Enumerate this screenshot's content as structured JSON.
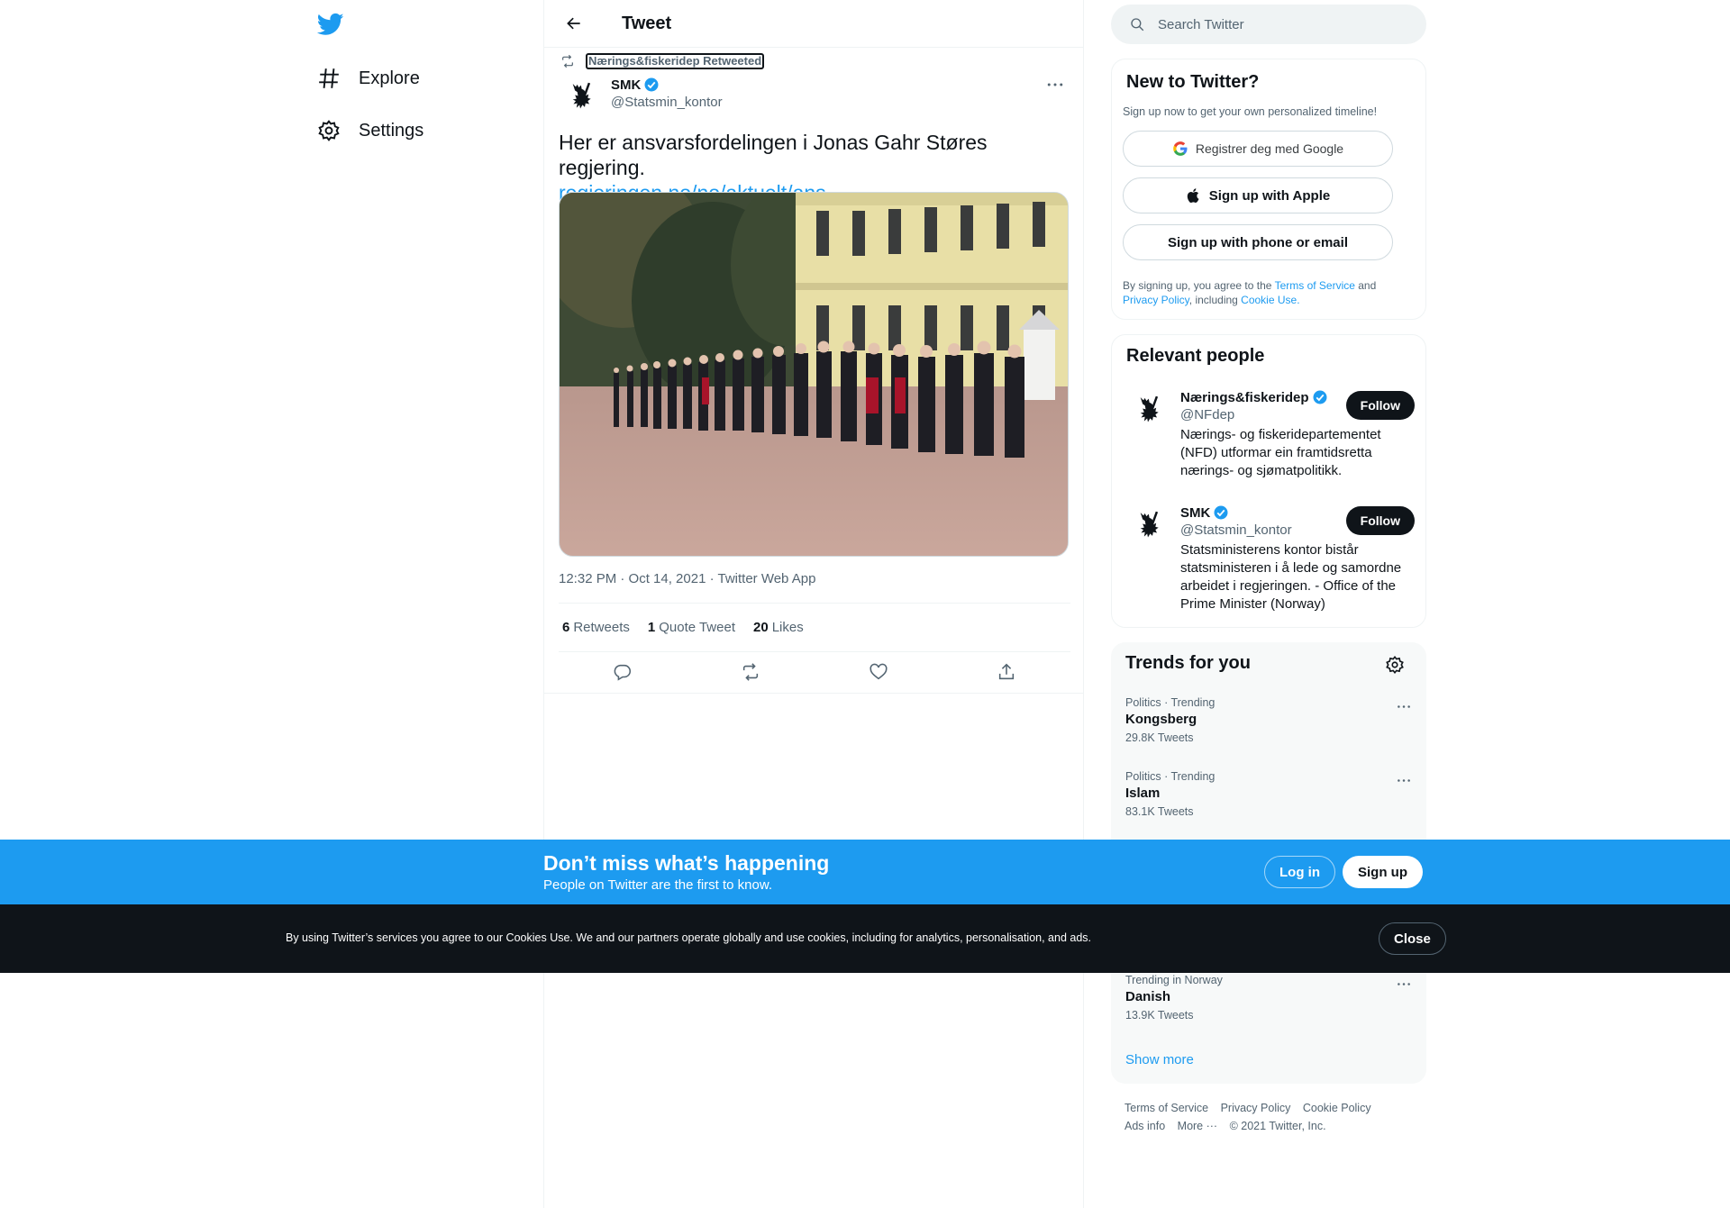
{
  "nav": {
    "explore": "Explore",
    "settings": "Settings"
  },
  "header": {
    "title": "Tweet"
  },
  "tweet": {
    "retweeted_by": "Nærings&fiskeridep Retweeted",
    "author_name": "SMK",
    "author_handle": "@Statsmin_kontor",
    "text": "Her er ansvarsfordelingen i Jonas Gahr Støres regjering.",
    "link": "regjeringen.no/no/aktuelt/ans…",
    "meta": "12:32 PM · Oct 14, 2021 · Twitter Web App",
    "stats": {
      "retweets_count": "6",
      "retweets_label": "Retweets",
      "quotes_count": "1",
      "quotes_label": "Quote Tweet",
      "likes_count": "20",
      "likes_label": "Likes"
    }
  },
  "search": {
    "placeholder": "Search Twitter"
  },
  "new_to_twitter": {
    "title": "New to Twitter?",
    "subtitle": "Sign up now to get your own personalized timeline!",
    "google_btn": "Registrer deg med Google",
    "apple_btn": "Sign up with Apple",
    "phone_btn": "Sign up with phone or email",
    "legal_prefix": "By signing up, you agree to the ",
    "terms": "Terms of Service",
    "and": " and ",
    "privacy": "Privacy Policy",
    "including": ", including ",
    "cookie_use": "Cookie Use."
  },
  "relevant": {
    "title": "Relevant people",
    "people": [
      {
        "name": "Nærings&fiskeridep",
        "handle": "@NFdep",
        "bio": "Nærings- og fiskeridepartementet (NFD) utformar ein framtidsretta nærings- og sjømatpolitikk.",
        "follow": "Follow"
      },
      {
        "name": "SMK",
        "handle": "@Statsmin_kontor",
        "bio": "Statsministerens kontor bistår statsministeren i å lede og samordne arbeidet i regjeringen. - Office of the Prime Minister (Norway)",
        "follow": "Follow"
      }
    ]
  },
  "trends": {
    "title": "Trends for you",
    "items": [
      {
        "meta": "Politics · Trending",
        "name": "Kongsberg",
        "count": "29.8K Tweets"
      },
      {
        "meta": "Politics · Trending",
        "name": "Islam",
        "count": "83.1K Tweets"
      },
      {
        "meta": "Trending in Norway",
        "name": "Danish",
        "count": "13.9K Tweets"
      }
    ],
    "show_more": "Show more"
  },
  "footer": {
    "terms": "Terms of Service",
    "privacy": "Privacy Policy",
    "cookie": "Cookie Policy",
    "ads": "Ads info",
    "more": "More ···",
    "copyright": "© 2021 Twitter, Inc."
  },
  "banner": {
    "title": "Don’t miss what’s happening",
    "subtitle": "People on Twitter are the first to know.",
    "login": "Log in",
    "signup": "Sign up"
  },
  "cookie": {
    "text": "By using Twitter’s services you agree to our Cookies Use. We and our partners operate globally and use cookies, including for analytics, personalisation, and ads.",
    "close": "Close"
  },
  "colors": {
    "accent": "#1d9bf0",
    "text": "#0f1419",
    "muted": "#536471",
    "cookie_bg": "#0f1419"
  }
}
